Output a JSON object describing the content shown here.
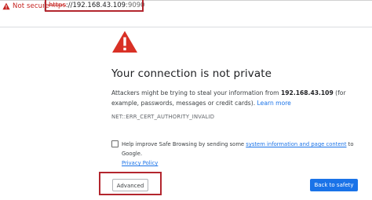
{
  "address_bar": {
    "security_label": "Not secure",
    "url_scheme": "https",
    "url_separator": "://",
    "url_host": "192.168.43.109",
    "url_port": ":9090",
    "security_color": "#c5221f"
  },
  "interstitial": {
    "icon": "warning-triangle-icon",
    "icon_color": "#d93025",
    "heading": "Your connection is not private",
    "description_prefix": "Attackers might be trying to steal your information from ",
    "description_host": "192.168.43.109",
    "description_suffix": " (for example, passwords, messages or credit cards). ",
    "learn_more": "Learn more",
    "error_code": "NET::ERR_CERT_AUTHORITY_INVALID",
    "safe_browsing": {
      "checked": false,
      "prefix": "Help improve Safe Browsing by sending some ",
      "link": "system information and page content",
      "suffix": " to Google. ",
      "privacy_link": "Privacy Policy"
    }
  },
  "buttons": {
    "advanced": "Advanced",
    "back_to_safety": "Back to safety",
    "primary_color": "#1a73e8"
  },
  "annotation_color": "#b3262e"
}
